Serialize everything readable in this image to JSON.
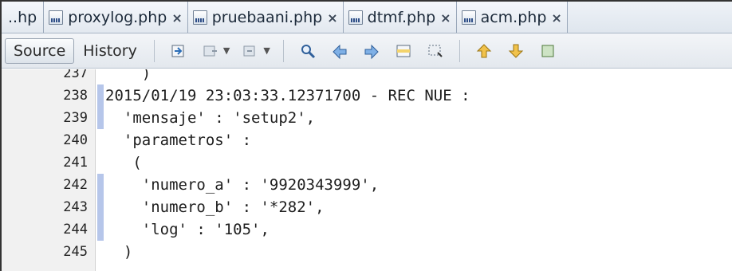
{
  "tabs": [
    {
      "label": "..hp",
      "closable": false,
      "icon": false
    },
    {
      "label": "proxylog.php",
      "closable": true,
      "icon": true
    },
    {
      "label": "pruebaani.php",
      "closable": true,
      "icon": true
    },
    {
      "label": "dtmf.php",
      "closable": true,
      "icon": true
    },
    {
      "label": "acm.php",
      "closable": true,
      "icon": true
    }
  ],
  "close_glyph": "×",
  "toolbar": {
    "source_label": "Source",
    "history_label": "History"
  },
  "editor": {
    "lines": [
      {
        "number": "237",
        "text": "    )",
        "changed": false
      },
      {
        "number": "238",
        "text": "2015/01/19 23:03:33.12371700 - REC NUE :",
        "changed": true
      },
      {
        "number": "239",
        "text": "  'mensaje' : 'setup2',",
        "changed": true
      },
      {
        "number": "240",
        "text": "  'parametros' :",
        "changed": false
      },
      {
        "number": "241",
        "text": "   (",
        "changed": false
      },
      {
        "number": "242",
        "text": "    'numero_a' : '9920343999',",
        "changed": true
      },
      {
        "number": "243",
        "text": "    'numero_b' : '*282',",
        "changed": true
      },
      {
        "number": "244",
        "text": "    'log' : '105',",
        "changed": true
      },
      {
        "number": "245",
        "text": "  )",
        "changed": false
      }
    ]
  },
  "colors": {
    "change_marker": "#b6c6ea"
  }
}
